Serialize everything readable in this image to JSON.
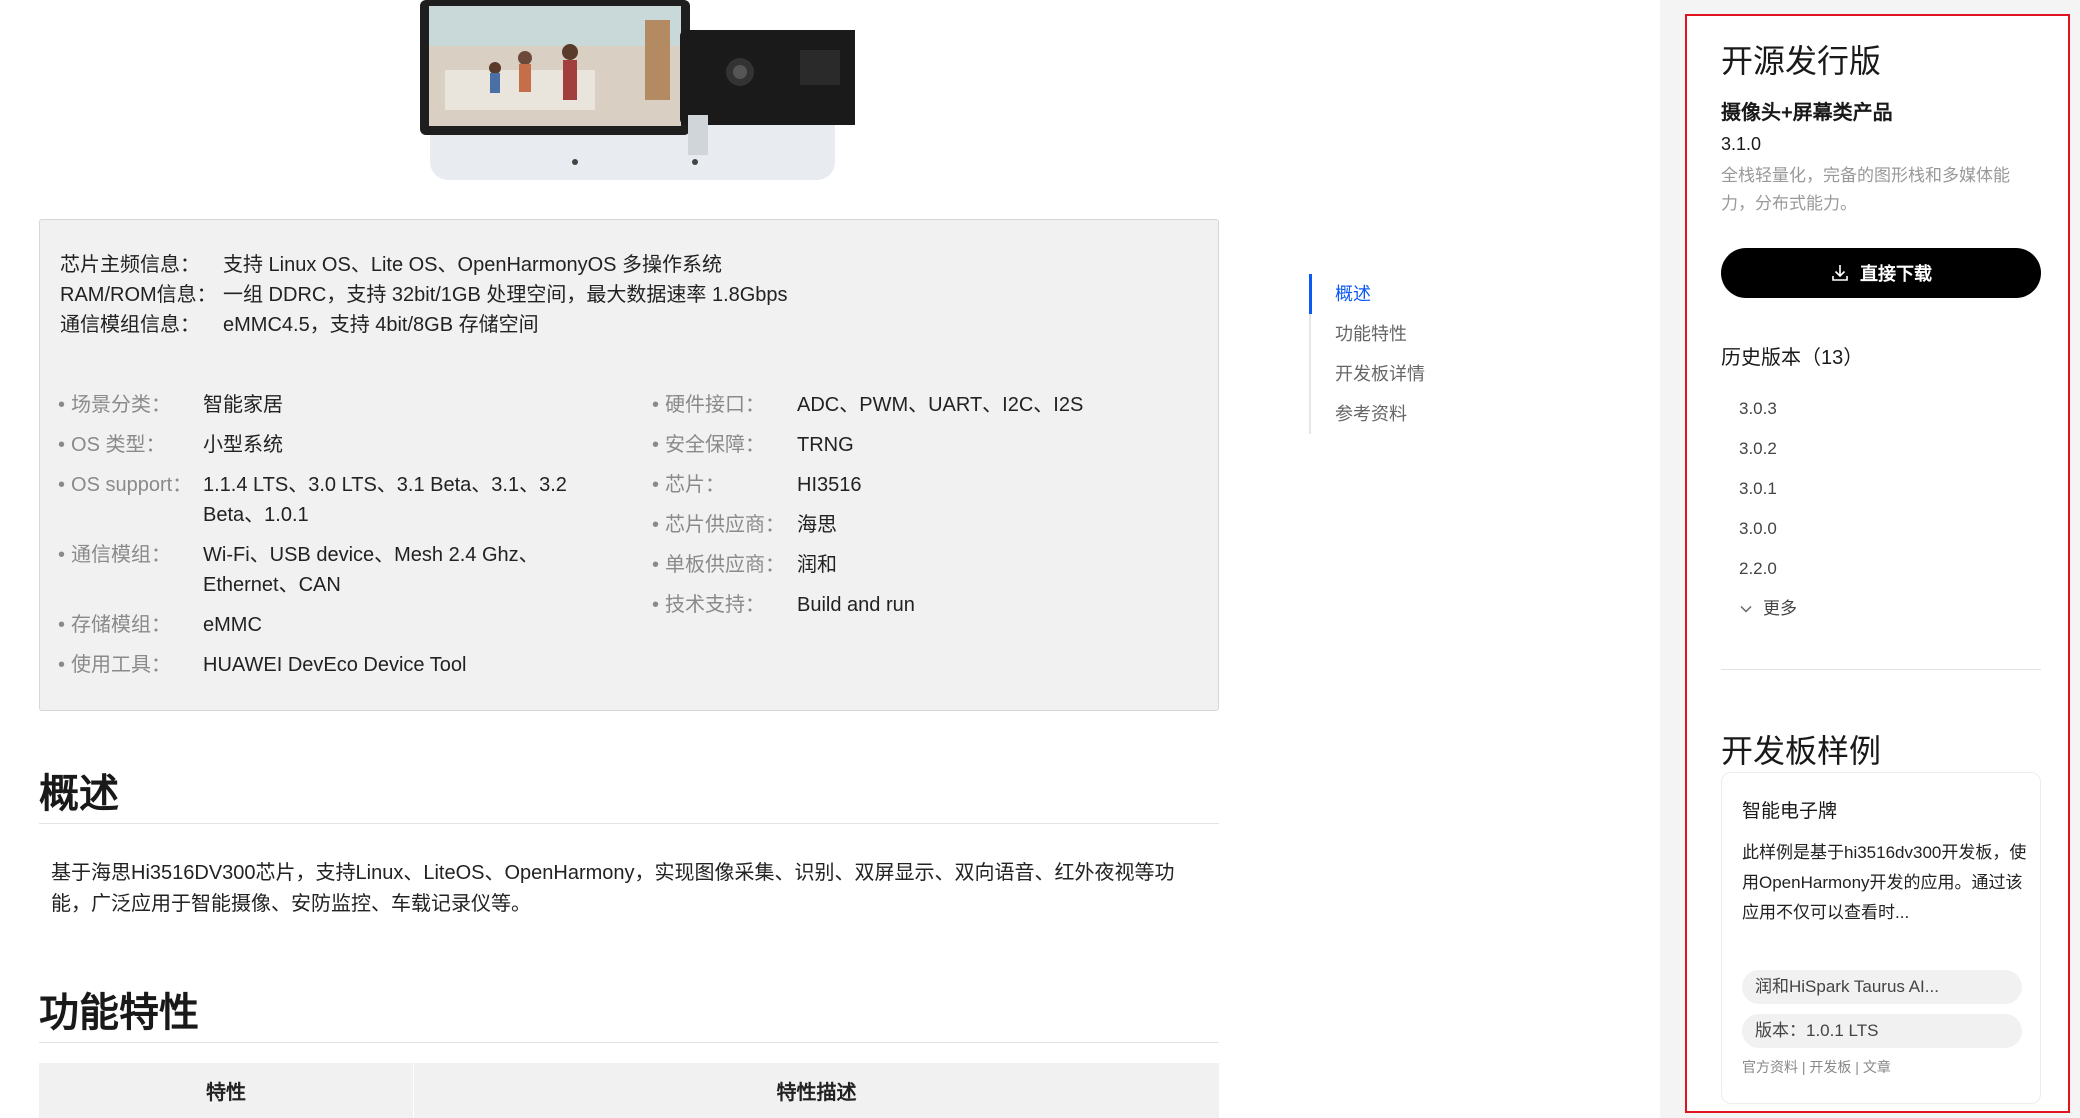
{
  "info": {
    "chip": [
      {
        "k": "芯片主频信息：",
        "v": "支持 Linux OS、Lite OS、OpenHarmonyOS 多操作系统"
      },
      {
        "k": "RAM/ROM信息：",
        "v": "一组 DDRC，支持 32bit/1GB 处理空间，最大数据速率 1.8Gbps"
      },
      {
        "k": "通信模组信息：",
        "v": "eMMC4.5，支持 4bit/8GB 存储空间"
      }
    ],
    "left_specs": [
      {
        "k": "场景分类：",
        "v": "智能家居"
      },
      {
        "k": "OS 类型：",
        "v": "小型系统"
      },
      {
        "k": "OS support：",
        "v": "1.1.4 LTS、3.0 LTS、3.1 Beta、3.1、3.2 Beta、1.0.1"
      },
      {
        "k": "通信模组：",
        "v": "Wi-Fi、USB device、Mesh 2.4 Ghz、Ethernet、CAN"
      },
      {
        "k": "存储模组：",
        "v": "eMMC"
      },
      {
        "k": "使用工具：",
        "v": "HUAWEI DevEco Device Tool"
      }
    ],
    "right_specs": [
      {
        "k": "硬件接口：",
        "v": "ADC、PWM、UART、I2C、I2S"
      },
      {
        "k": "安全保障：",
        "v": "TRNG"
      },
      {
        "k": "芯片：",
        "v": "HI3516"
      },
      {
        "k": "芯片供应商：",
        "v": "海思"
      },
      {
        "k": "单板供应商：",
        "v": "润和"
      },
      {
        "k": "技术支持：",
        "v": "Build and run"
      }
    ]
  },
  "overview": {
    "title": "概述",
    "text": "基于海思Hi3516DV300芯片，支持Linux、LiteOS、OpenHarmony，实现图像采集、识别、双屏显示、双向语音、红外夜视等功能，广泛应用于智能摄像、安防监控、车载记录仪等。"
  },
  "features": {
    "title": "功能特性",
    "col1": "特性",
    "col2": "特性描述"
  },
  "anchors": [
    {
      "label": "概述",
      "active": true
    },
    {
      "label": "功能特性",
      "active": false
    },
    {
      "label": "开发板详情",
      "active": false
    },
    {
      "label": "参考资料",
      "active": false
    }
  ],
  "release": {
    "title": "开源发行版",
    "product": "摄像头+屏幕类产品",
    "version": "3.1.0",
    "desc": "全栈轻量化，完备的图形栈和多媒体能力，分布式能力。",
    "download": "直接下载",
    "history_title": "历史版本（13）",
    "history": [
      "3.0.3",
      "3.0.2",
      "3.0.1",
      "3.0.0",
      "2.2.0"
    ],
    "more": "更多"
  },
  "samples": {
    "title": "开发板样例",
    "card": {
      "title": "智能电子牌",
      "desc": "此样例是基于hi3516dv300开发板，使用OpenHarmony开发的应用。通过该应用不仅可以查看时...",
      "board_tag": "润和HiSpark Taurus AI...",
      "version_tag": "版本：1.0.1 LTS",
      "footer": "官方资料 | 开发板 | 文章"
    }
  },
  "colors": {
    "accent": "#0a59f7",
    "highlight_border": "#e0141e"
  }
}
